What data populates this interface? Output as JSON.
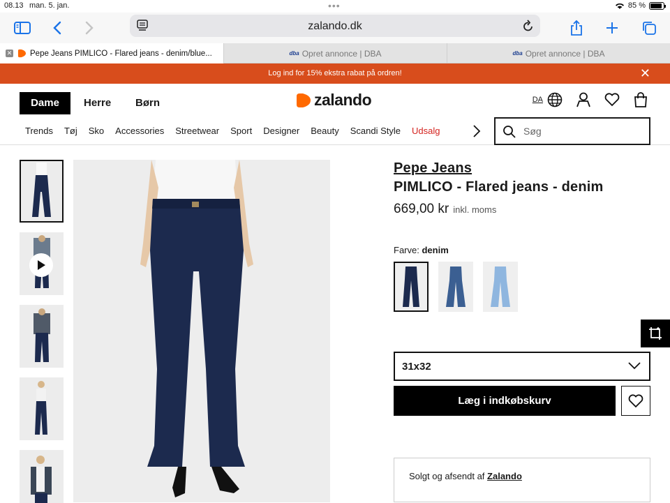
{
  "status_bar": {
    "time": "08.13",
    "date": "man. 5. jan.",
    "battery": "85 %"
  },
  "browser": {
    "url": "zalando.dk",
    "tabs": [
      {
        "title": "Pepe Jeans PIMLICO - Flared jeans - denim/blue...",
        "active": true
      },
      {
        "title": "Opret annonce | DBA",
        "favicon": "dba",
        "active": false
      },
      {
        "title": "Opret annonce | DBA",
        "favicon": "dba",
        "active": false
      }
    ]
  },
  "promo": {
    "text": "Log ind for 15% ekstra rabat på ordren!"
  },
  "header": {
    "genders": [
      "Dame",
      "Herre",
      "Børn"
    ],
    "logo": "zalando",
    "lang": "DA",
    "nav": [
      "Trends",
      "Tøj",
      "Sko",
      "Accessories",
      "Streetwear",
      "Sport",
      "Designer",
      "Beauty",
      "Scandi Style",
      "Udsalg"
    ],
    "search_placeholder": "Søg"
  },
  "product": {
    "brand": "Pepe Jeans",
    "name": "PIMLICO - Flared jeans - denim",
    "price": "669,00 kr",
    "vat_note": "inkl. moms",
    "color_label": "Farve:",
    "color_value": "denim",
    "swatch_colors": [
      "#1c2a4e",
      "#3b5f92",
      "#8fb6df"
    ],
    "size": "31x32",
    "add_to_cart": "Læg i indkøbskurv",
    "sold_by_prefix": "Solgt og afsendt af",
    "sold_by": "Zalando"
  },
  "colors": {
    "accent": "#d84d1c",
    "sale": "#d4231f",
    "logo_orange": "#ff6900"
  }
}
